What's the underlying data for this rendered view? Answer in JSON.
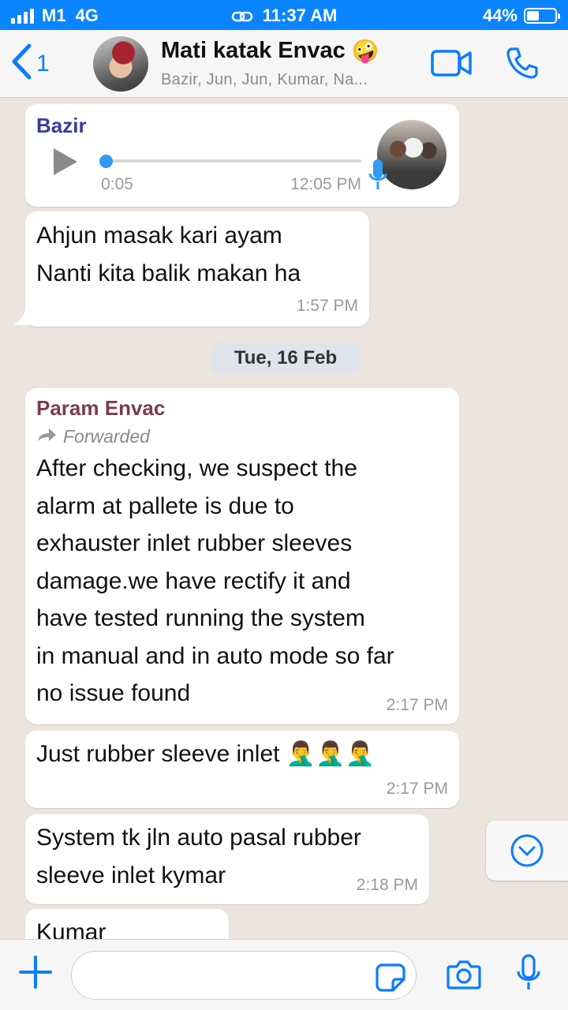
{
  "status_bar": {
    "carrier": "M1",
    "network": "4G",
    "time": "11:37 AM",
    "battery": "44%",
    "battery_level": 0.44
  },
  "header": {
    "back_count": "1",
    "group_name": "Mati katak Envac",
    "group_emoji": "🤪",
    "members": "Bazir, Jun, Jun, Kumar, Na..."
  },
  "messages": [
    {
      "type": "voice",
      "sender": "Bazir",
      "sender_color": "#3a3a9c",
      "duration": "0:05",
      "time": "12:05 PM"
    },
    {
      "type": "text",
      "text": "Ahjun masak kari ayam\nNanti kita balik makan ha",
      "time": "1:57 PM"
    },
    {
      "type": "date",
      "text": "Tue, 16 Feb"
    },
    {
      "type": "text",
      "sender": "Param Envac",
      "sender_color": "#7a3b52",
      "forwarded_label": "Forwarded",
      "text": "After  checking,  we suspect  the\nalarm at pallete is due to\nexhauster  inlet rubber sleeves\ndamage.we have rectify it and\nhave tested running  the system\nin manual and  in auto mode so far\nno issue  found",
      "time": "2:17 PM"
    },
    {
      "type": "text",
      "text": "Just rubber sleeve inlet 🤦‍♂️🤦‍♂️🤦‍♂️",
      "time": "2:17 PM"
    },
    {
      "type": "text",
      "text": "System tk jln auto pasal rubber\nsleeve inlet kymar",
      "time": "2:18 PM"
    },
    {
      "type": "text",
      "text": "Kumar"
    }
  ],
  "input": {
    "placeholder": ""
  },
  "colors": {
    "accent": "#0a84ff",
    "chat_background": "#ebe5de",
    "bubble": "#ffffff"
  },
  "icons": {
    "back": "chevron-left-icon",
    "video": "video-camera-icon",
    "call": "phone-icon",
    "play": "play-icon",
    "mic": "microphone-icon",
    "scroll": "chevron-down-circle-icon",
    "attach": "plus-icon",
    "sticker": "sticker-icon",
    "camera": "camera-icon"
  }
}
